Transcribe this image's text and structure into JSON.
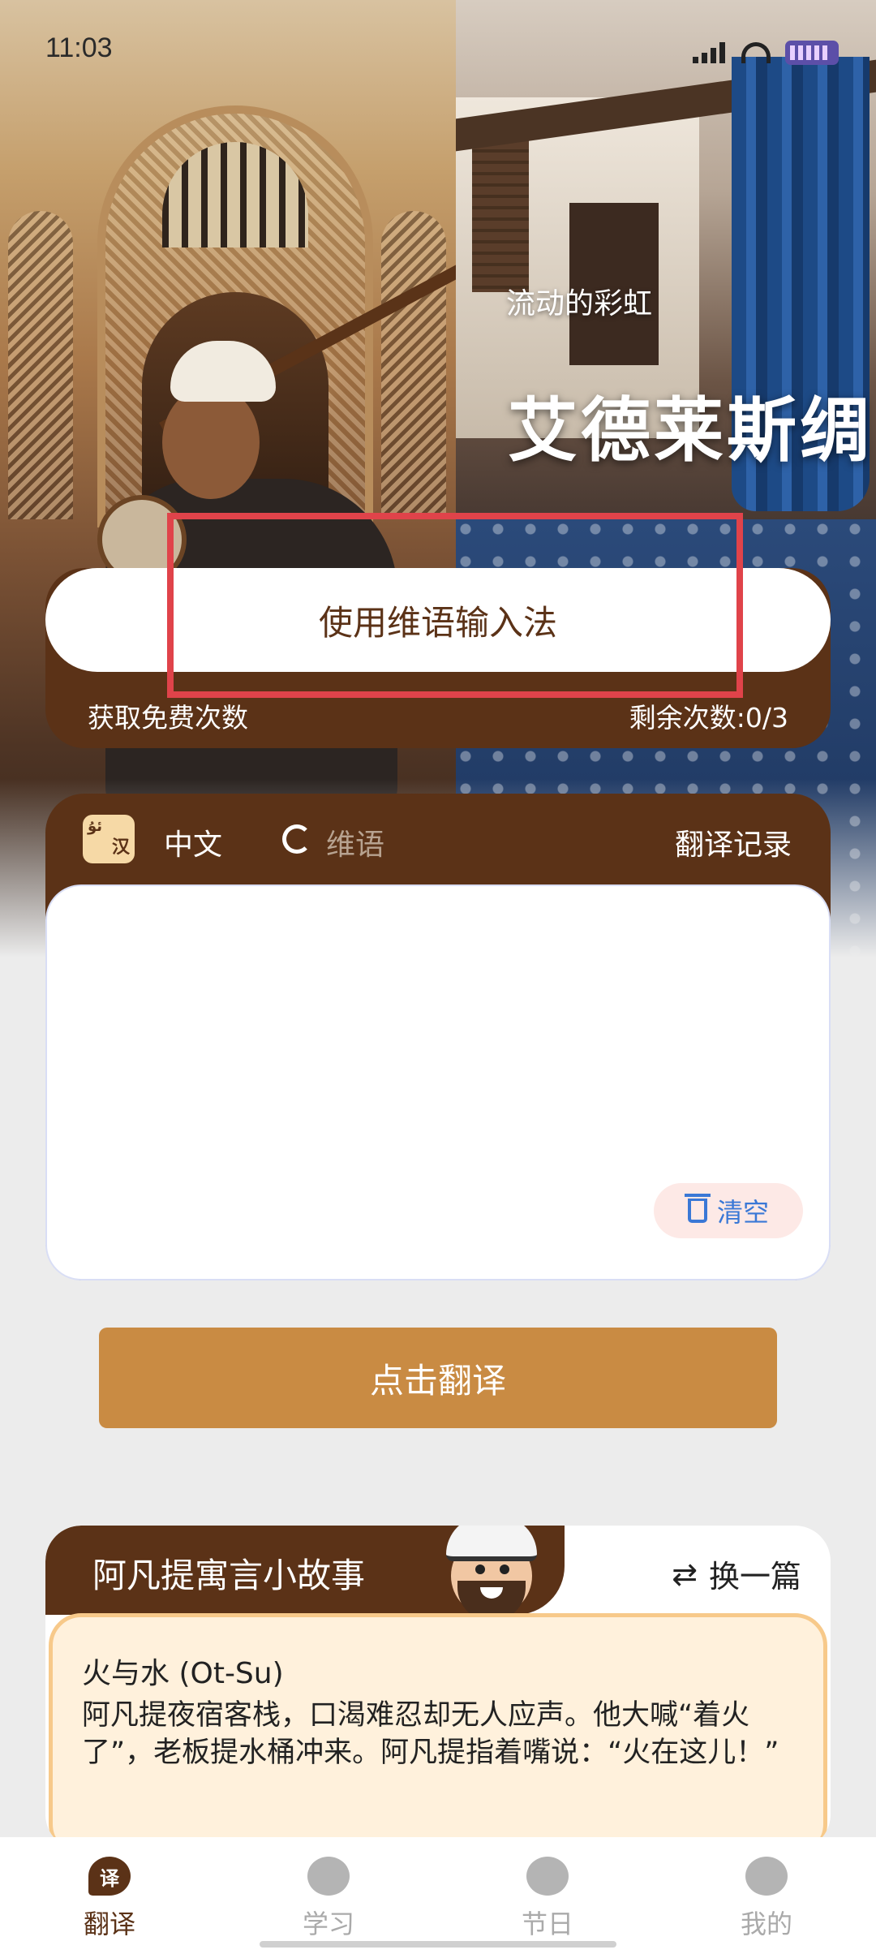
{
  "status": {
    "time": "11:03"
  },
  "hero": {
    "subtitle": "流动的彩虹",
    "title": "艾德莱斯绸"
  },
  "ime": {
    "button_label": "使用维语输入法",
    "get_free_label": "获取免费次数",
    "remaining_label": "剩余次数:0/3"
  },
  "translate": {
    "icon_top": "ئۇ",
    "icon_bottom": "汉",
    "lang_from": "中文",
    "lang_to": "维语",
    "history_label": "翻译记录",
    "input_value": "",
    "clear_label": "清空",
    "translate_button": "点击翻译"
  },
  "story": {
    "section_title": "阿凡提寓言小故事",
    "switch_label": "换一篇",
    "heading": "火与水 (Ot-Su)",
    "text": " 阿凡提夜宿客栈，口渴难忍却无人应声。他大喊“着火了”，老板提水桶冲来。阿凡提指着嘴说：“火在这儿！”"
  },
  "nav": {
    "items": [
      {
        "label": "翻译",
        "icon": "translate-icon",
        "icon_char": "译",
        "active": true
      },
      {
        "label": "学习",
        "icon": "book-reader-icon",
        "icon_char": "",
        "active": false
      },
      {
        "label": "节日",
        "icon": "balloon-icon",
        "icon_char": "",
        "active": false
      },
      {
        "label": "我的",
        "icon": "user-icon",
        "icon_char": "",
        "active": false
      }
    ]
  },
  "colors": {
    "brand_brown": "#5b3217",
    "translate_button": "#c98b43",
    "highlight_box": "#e0434a",
    "clear_text": "#3a78d6"
  }
}
